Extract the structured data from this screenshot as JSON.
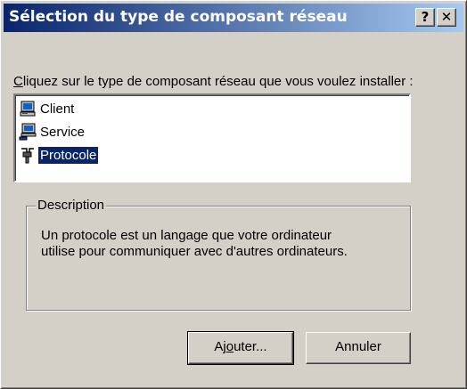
{
  "window": {
    "title": "Sélection du type de composant réseau",
    "help_button": "?",
    "close_button": "✕"
  },
  "prompt": {
    "accel": "C",
    "rest": "liquez sur le type de composant réseau que vous voulez installer :"
  },
  "list": {
    "items": [
      {
        "label": "Client",
        "icon": "client-computer-icon",
        "selected": false
      },
      {
        "label": "Service",
        "icon": "service-computer-icon",
        "selected": false
      },
      {
        "label": "Protocole",
        "icon": "protocol-plug-icon",
        "selected": true
      }
    ]
  },
  "description": {
    "legend": "Description",
    "text_line1": "Un protocole est un langage que votre ordinateur",
    "text_line2": "utilise pour communiquer avec d'autres ordinateurs."
  },
  "buttons": {
    "add_pre": "Aj",
    "add_accel": "o",
    "add_post": "uter...",
    "cancel": "Annuler"
  },
  "colors": {
    "title_start": "#0a246a",
    "title_end": "#a6caf0",
    "face": "#d4d0c8",
    "selection": "#0a246a"
  }
}
